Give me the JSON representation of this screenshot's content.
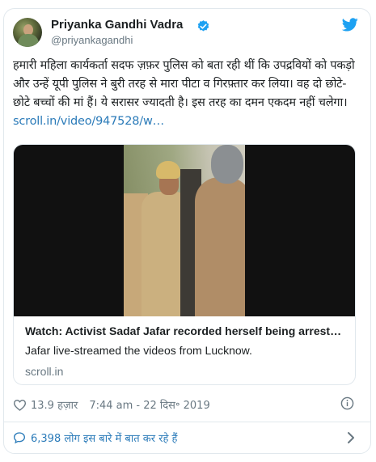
{
  "tweet": {
    "author_name": "Priyanka Gandhi Vadra",
    "handle": "@priyankagandhi",
    "text": "हमारी महिला कार्यकर्ता सदफ ज़फ़र पुलिस को बता रही थीं कि उपद्रवियों को पकड़ो और उन्हें यूपी पुलिस ने बुरी तरह से मारा पीटा व गिरफ़्तार कर लिया। वह दो छोटे-छोटे बच्चों की मां हैं। ये सरासर ज्यादती है। इस तरह का दमन एकदम नहीं चलेगा।",
    "link_text": "scroll.in/video/947528/w…",
    "verified_color": "#1da1f2",
    "brand_color": "#1da1f2"
  },
  "card": {
    "title": "Watch: Activist Sadaf Jafar recorded herself being arrest…",
    "description": "Jafar live-streamed the videos from Lucknow.",
    "domain": "scroll.in"
  },
  "meta": {
    "likes": "13.9 हज़ार",
    "timestamp": "7:44 am - 22 दिस॰ 2019"
  },
  "conversation": {
    "label": "6,398 लोग इस बारे में बात कर रहे हैं"
  },
  "icons": [
    "avatar",
    "verified-icon",
    "twitter-bird-icon",
    "heart-icon",
    "info-icon",
    "reply-icon",
    "chevron-right-icon"
  ]
}
